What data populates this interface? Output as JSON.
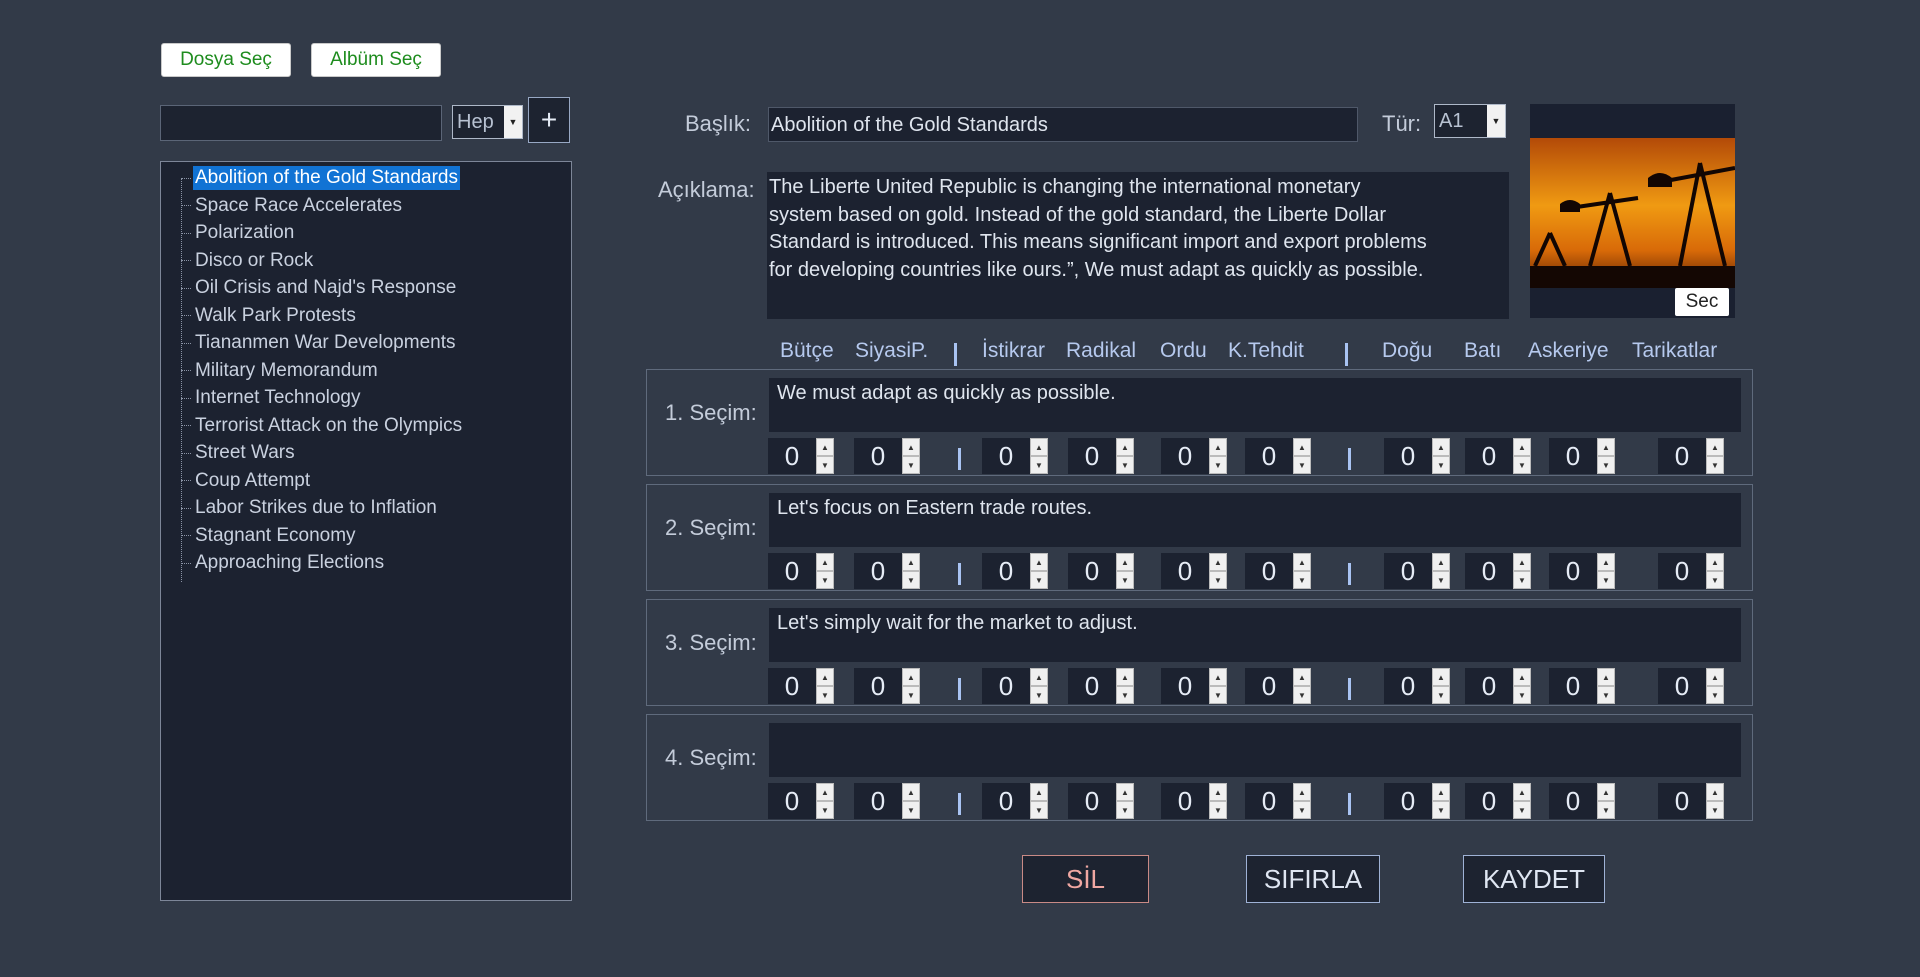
{
  "toolbar": {
    "file_button": "Dosya Seç",
    "album_button": "Albüm Seç"
  },
  "filter": {
    "search_value": "",
    "type_value": "Hep",
    "add_label": "+"
  },
  "tree": {
    "items": [
      "Abolition of the Gold Standards",
      "Space Race Accelerates",
      "Polarization",
      "Disco or Rock",
      "Oil Crisis and Najd's Response",
      "Walk Park Protests",
      "Tiananmen War Developments",
      "Military Memorandum",
      "Internet Technology",
      "Terrorist Attack on the Olympics",
      "Street Wars",
      "Coup Attempt",
      "Labor Strikes due to Inflation",
      "Stagnant Economy",
      "Approaching Elections"
    ],
    "selected_index": 0
  },
  "form": {
    "title_label": "Başlık:",
    "title_value": "Abolition of the Gold Standards",
    "type_label": "Tür:",
    "type_value": "A1",
    "description_label": "Açıklama:",
    "description_lines": [
      "The Liberte United Republic is changing the international monetary",
      "system based on gold. Instead of the gold standard, the Liberte Dollar",
      "Standard is introduced. This means significant import and export problems",
      "for developing countries like ours.”, We must adapt as quickly as possible."
    ],
    "image_button": "Sec"
  },
  "columns": [
    "Bütçe",
    "SiyasiP.",
    "İstikrar",
    "Radikal",
    "Ordu",
    "K.Tehdit",
    "Doğu",
    "Batı",
    "Askeriye",
    "Tarikatlar"
  ],
  "choices": [
    {
      "label": "1. Seçim:",
      "text": "We must adapt as quickly as possible.",
      "values": [
        "0",
        "0",
        "0",
        "0",
        "0",
        "0",
        "0",
        "0",
        "0",
        "0"
      ]
    },
    {
      "label": "2. Seçim:",
      "text": "Let's focus on Eastern trade routes.",
      "values": [
        "0",
        "0",
        "0",
        "0",
        "0",
        "0",
        "0",
        "0",
        "0",
        "0"
      ]
    },
    {
      "label": "3. Seçim:",
      "text": "Let's simply wait for the market to adjust.",
      "values": [
        "0",
        "0",
        "0",
        "0",
        "0",
        "0",
        "0",
        "0",
        "0",
        "0"
      ]
    },
    {
      "label": "4. Seçim:",
      "text": "",
      "values": [
        "0",
        "0",
        "0",
        "0",
        "0",
        "0",
        "0",
        "0",
        "0",
        "0"
      ]
    }
  ],
  "actions": {
    "delete": "SİL",
    "reset": "SIFIRLA",
    "save": "KAYDET"
  },
  "colors": {
    "background": "#323a48",
    "field": "#1c2230",
    "selection": "#1173d4",
    "header_text": "#b6c9ee",
    "delete_border": "#c98a86",
    "green_text": "#1e8c1e"
  }
}
